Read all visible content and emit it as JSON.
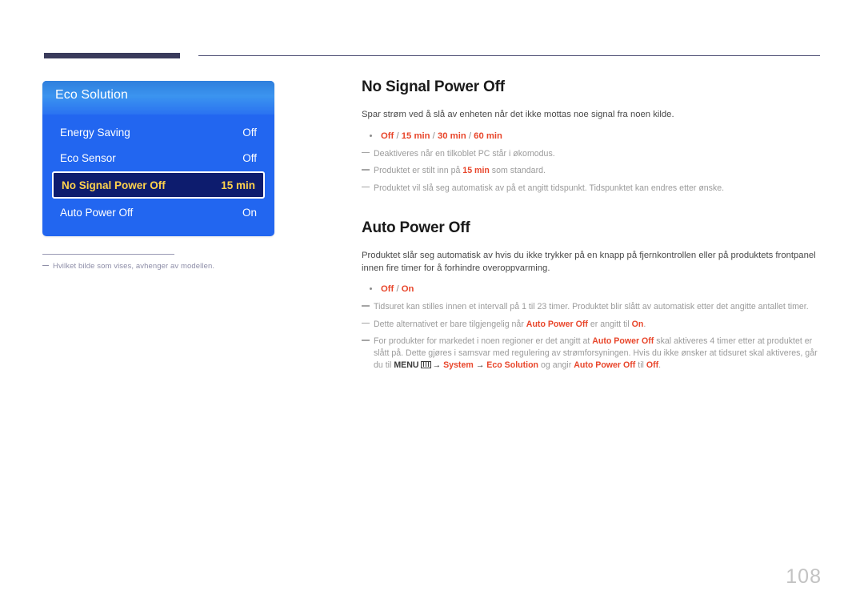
{
  "header": {
    "rule_accent_color": "#3a3b5c",
    "rule_line_color": "#55567a"
  },
  "osd": {
    "title": "Eco Solution",
    "panel_color": "#2266f0",
    "selected_bg_color": "#0d1c6e",
    "selected_text_color": "#ffd24d",
    "rows": [
      {
        "label": "Energy Saving",
        "value": "Off",
        "selected": false
      },
      {
        "label": "Eco Sensor",
        "value": "Off",
        "selected": false
      },
      {
        "label": "No Signal Power Off",
        "value": "15 min",
        "selected": true
      },
      {
        "label": "Auto Power Off",
        "value": "On",
        "selected": false
      }
    ],
    "caption": "Hvilket bilde som vises, avhenger av modellen."
  },
  "article": {
    "accent_color": "#e8462b",
    "sections": [
      {
        "title": "No Signal Power Off",
        "lead": "Spar strøm ved å slå av enheten når det ikke mottas noe signal fra noen kilde.",
        "options": [
          {
            "opt1": "Off",
            "sep1": " / ",
            "opt2": "15 min",
            "sep2": " / ",
            "opt3": "30 min",
            "sep3": " / ",
            "opt4": "60 min"
          }
        ],
        "notes": [
          {
            "text": "Deaktiveres når en tilkoblet PC står i økomodus."
          },
          {
            "pre": "Produktet er stilt inn på ",
            "hl": "15 min",
            "post": " som standard."
          },
          {
            "text": "Produktet vil slå seg automatisk av på et angitt tidspunkt. Tidspunktet kan endres etter ønske."
          }
        ]
      },
      {
        "title": "Auto Power Off",
        "lead": "Produktet slår seg automatisk av hvis du ikke trykker på en knapp på fjernkontrollen eller på produktets frontpanel innen fire timer for å forhindre overoppvarming.",
        "options": [
          {
            "opt1": "Off",
            "sep1": " / ",
            "opt2": "On"
          }
        ],
        "notes": [
          {
            "text": "Tidsuret kan stilles innen et intervall på 1 til 23 timer. Produktet blir slått av automatisk etter det angitte antallet timer."
          },
          {
            "pre": "Dette alternativet er bare tilgjengelig når ",
            "hl": "Auto Power Off",
            "mid": " er angitt til ",
            "hl2": "On",
            "post": "."
          },
          {
            "pre": "For produkter for markedet i noen regioner er det angitt at ",
            "hl": "Auto Power Off",
            "mid": " skal aktiveres 4 timer etter at produktet er slått på. Dette gjøres i samsvar med regulering av strømforsyningen. Hvis du ikke ønsker at tidsuret skal aktiveres, går du til ",
            "path_menu": "MENU",
            "path_arrow1": "→",
            "path_1": "System",
            "path_arrow2": "→",
            "path_2": "Eco Solution",
            "path_mid": " og angir ",
            "path_3": "Auto Power Off",
            "path_til": " til ",
            "path_4": "Off",
            "post": "."
          }
        ]
      }
    ]
  },
  "footer": {
    "page_number": "108"
  }
}
